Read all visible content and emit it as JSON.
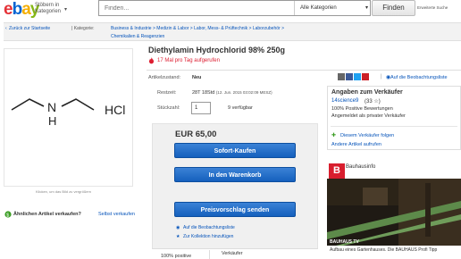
{
  "header": {
    "logo_letters": [
      "e",
      "b",
      "a",
      "y"
    ],
    "logo_colors": [
      "#e53238",
      "#0064d2",
      "#f5af02",
      "#86b817"
    ],
    "shop_by": "Stöbern in Kategorien",
    "search_placeholder": "Finden...",
    "category_select": "Alle Kategorien",
    "search_button": "Finden",
    "advanced_search": "Erweiterte Suche"
  },
  "breadcrumb": {
    "back_link": "Zurück zur Startseite",
    "categories_label": "| Kategorie:",
    "path_line1": "Business & Industrie  >  Medizin & Labor  >  Labor, Mess- & Prüftechnik  >  Laborzubehör  >",
    "path_line2": "Chemikalien & Reagenzien"
  },
  "image_panel": {
    "caption": "Klicken, um das Bild zu vergrößern",
    "molecule_atom": "N",
    "molecule_hydrogen": "H",
    "salt_label": "HCl"
  },
  "similar": {
    "text": "Ähnlichen Artikel verkaufen?",
    "link": "Selbst verkaufen"
  },
  "listing": {
    "title": "Diethylamin Hydrochlorid 98% 250g",
    "views": "17 Mal pro Tag aufgerufen",
    "condition_label": "Artikelzustand:",
    "condition_value": "Neu",
    "watch_link": "Auf die Beobachtungsliste",
    "time_label": "Restzeit:",
    "time_value": "28T 18Std",
    "time_detail": "(12. Jun. 2015   03:02:09 MESZ)",
    "qty_label": "Stückzahl:",
    "qty_value": "1",
    "qty_available": "9 verfügbar"
  },
  "buy_box": {
    "price": "EUR 65,00",
    "buy_now": "Sofort-Kaufen",
    "add_to_cart": "In den Warenkorb",
    "make_offer": "Preisvorschlag senden",
    "watch": "Auf die Beobachtungsliste",
    "collection": "Zur Kollektion hinzufügen",
    "stat1": "100% positive",
    "stat2": "Verkäufer"
  },
  "seller": {
    "title": "Angaben zum Verkäufer",
    "name": "14science9",
    "feedback": "(33 ☆)",
    "positive": "100% Positive Bewertungen",
    "type": "Angemeldet als privater Verkäufer",
    "follow": "Diesem Verkäufer folgen",
    "other_items": "Andere Artikel aufrufen"
  },
  "ad": {
    "logo_letter": "B",
    "brand": "Bauhausinfo",
    "label": "BAUHAUS TV",
    "text": "Aufbau eines Gartenhauses. Die BAUHAUS Profi Tipp"
  },
  "colors": {
    "link": "#0654ba",
    "button": "#1560bd",
    "alert": "#dd1e31",
    "follow": "#3a9d23"
  }
}
